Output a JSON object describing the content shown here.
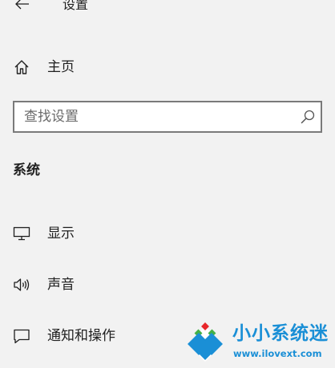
{
  "header": {
    "back_icon": "arrow-left-icon",
    "title": "设置"
  },
  "nav": {
    "home": {
      "icon": "home-icon",
      "label": "主页"
    }
  },
  "search": {
    "placeholder": "查找设置",
    "value": "",
    "icon": "search-icon"
  },
  "section": {
    "title": "系统",
    "items": [
      {
        "icon": "monitor-icon",
        "label": "显示"
      },
      {
        "icon": "speaker-icon",
        "label": "声音"
      },
      {
        "icon": "notification-icon",
        "label": "通知和操作"
      }
    ]
  },
  "watermark": {
    "title": "小小系统迷",
    "url": "www.ilovext.com",
    "colors": {
      "blue": "#1a8fd6",
      "red": "#e8262a",
      "green": "#43b047"
    }
  }
}
